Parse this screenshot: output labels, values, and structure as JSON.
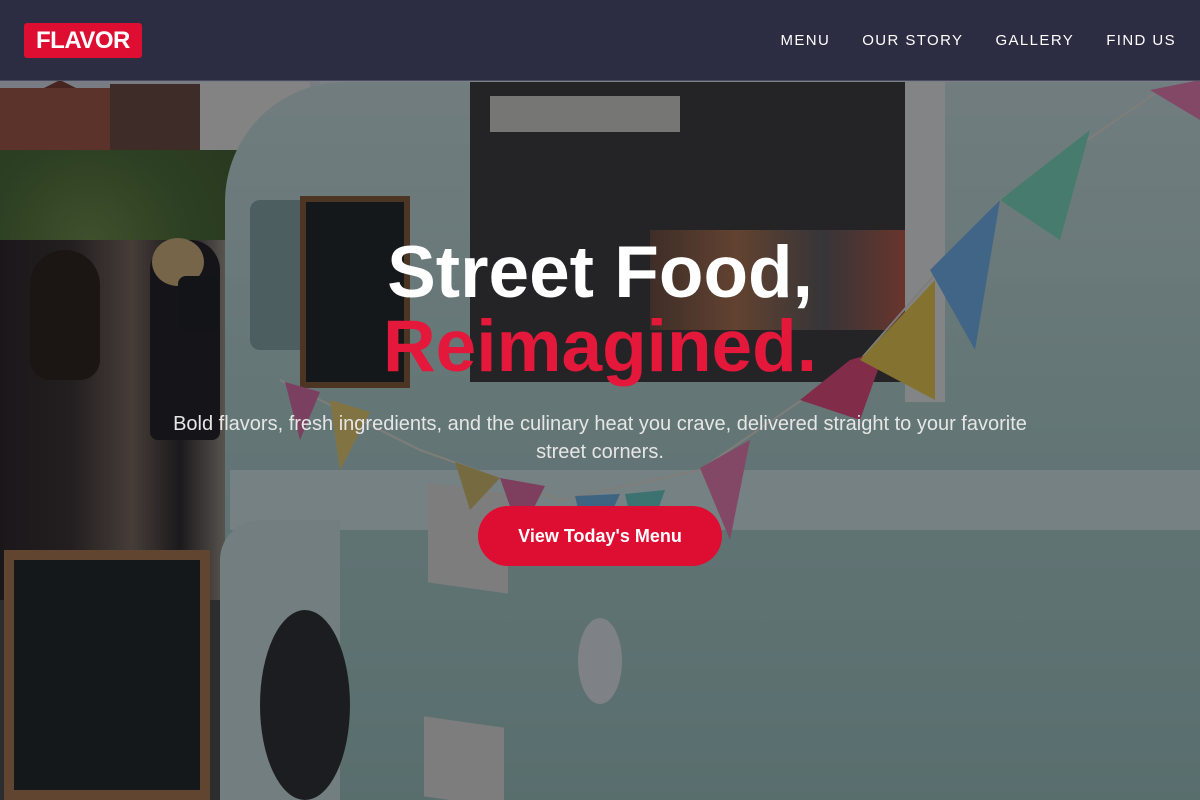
{
  "brand": {
    "logo_text": "FLAVOR",
    "accent_color": "#de0d32"
  },
  "nav": {
    "items": [
      {
        "label": "MENU"
      },
      {
        "label": "OUR STORY"
      },
      {
        "label": "GALLERY"
      },
      {
        "label": "FIND US"
      }
    ]
  },
  "hero": {
    "headline_line1": "Street Food,",
    "headline_line2": "Reimagined.",
    "subtitle": "Bold flavors, fresh ingredients, and the culinary heat you crave, delivered straight to your favorite street corners.",
    "cta_label": "View Today's Menu",
    "background_image": "food truck photo"
  }
}
